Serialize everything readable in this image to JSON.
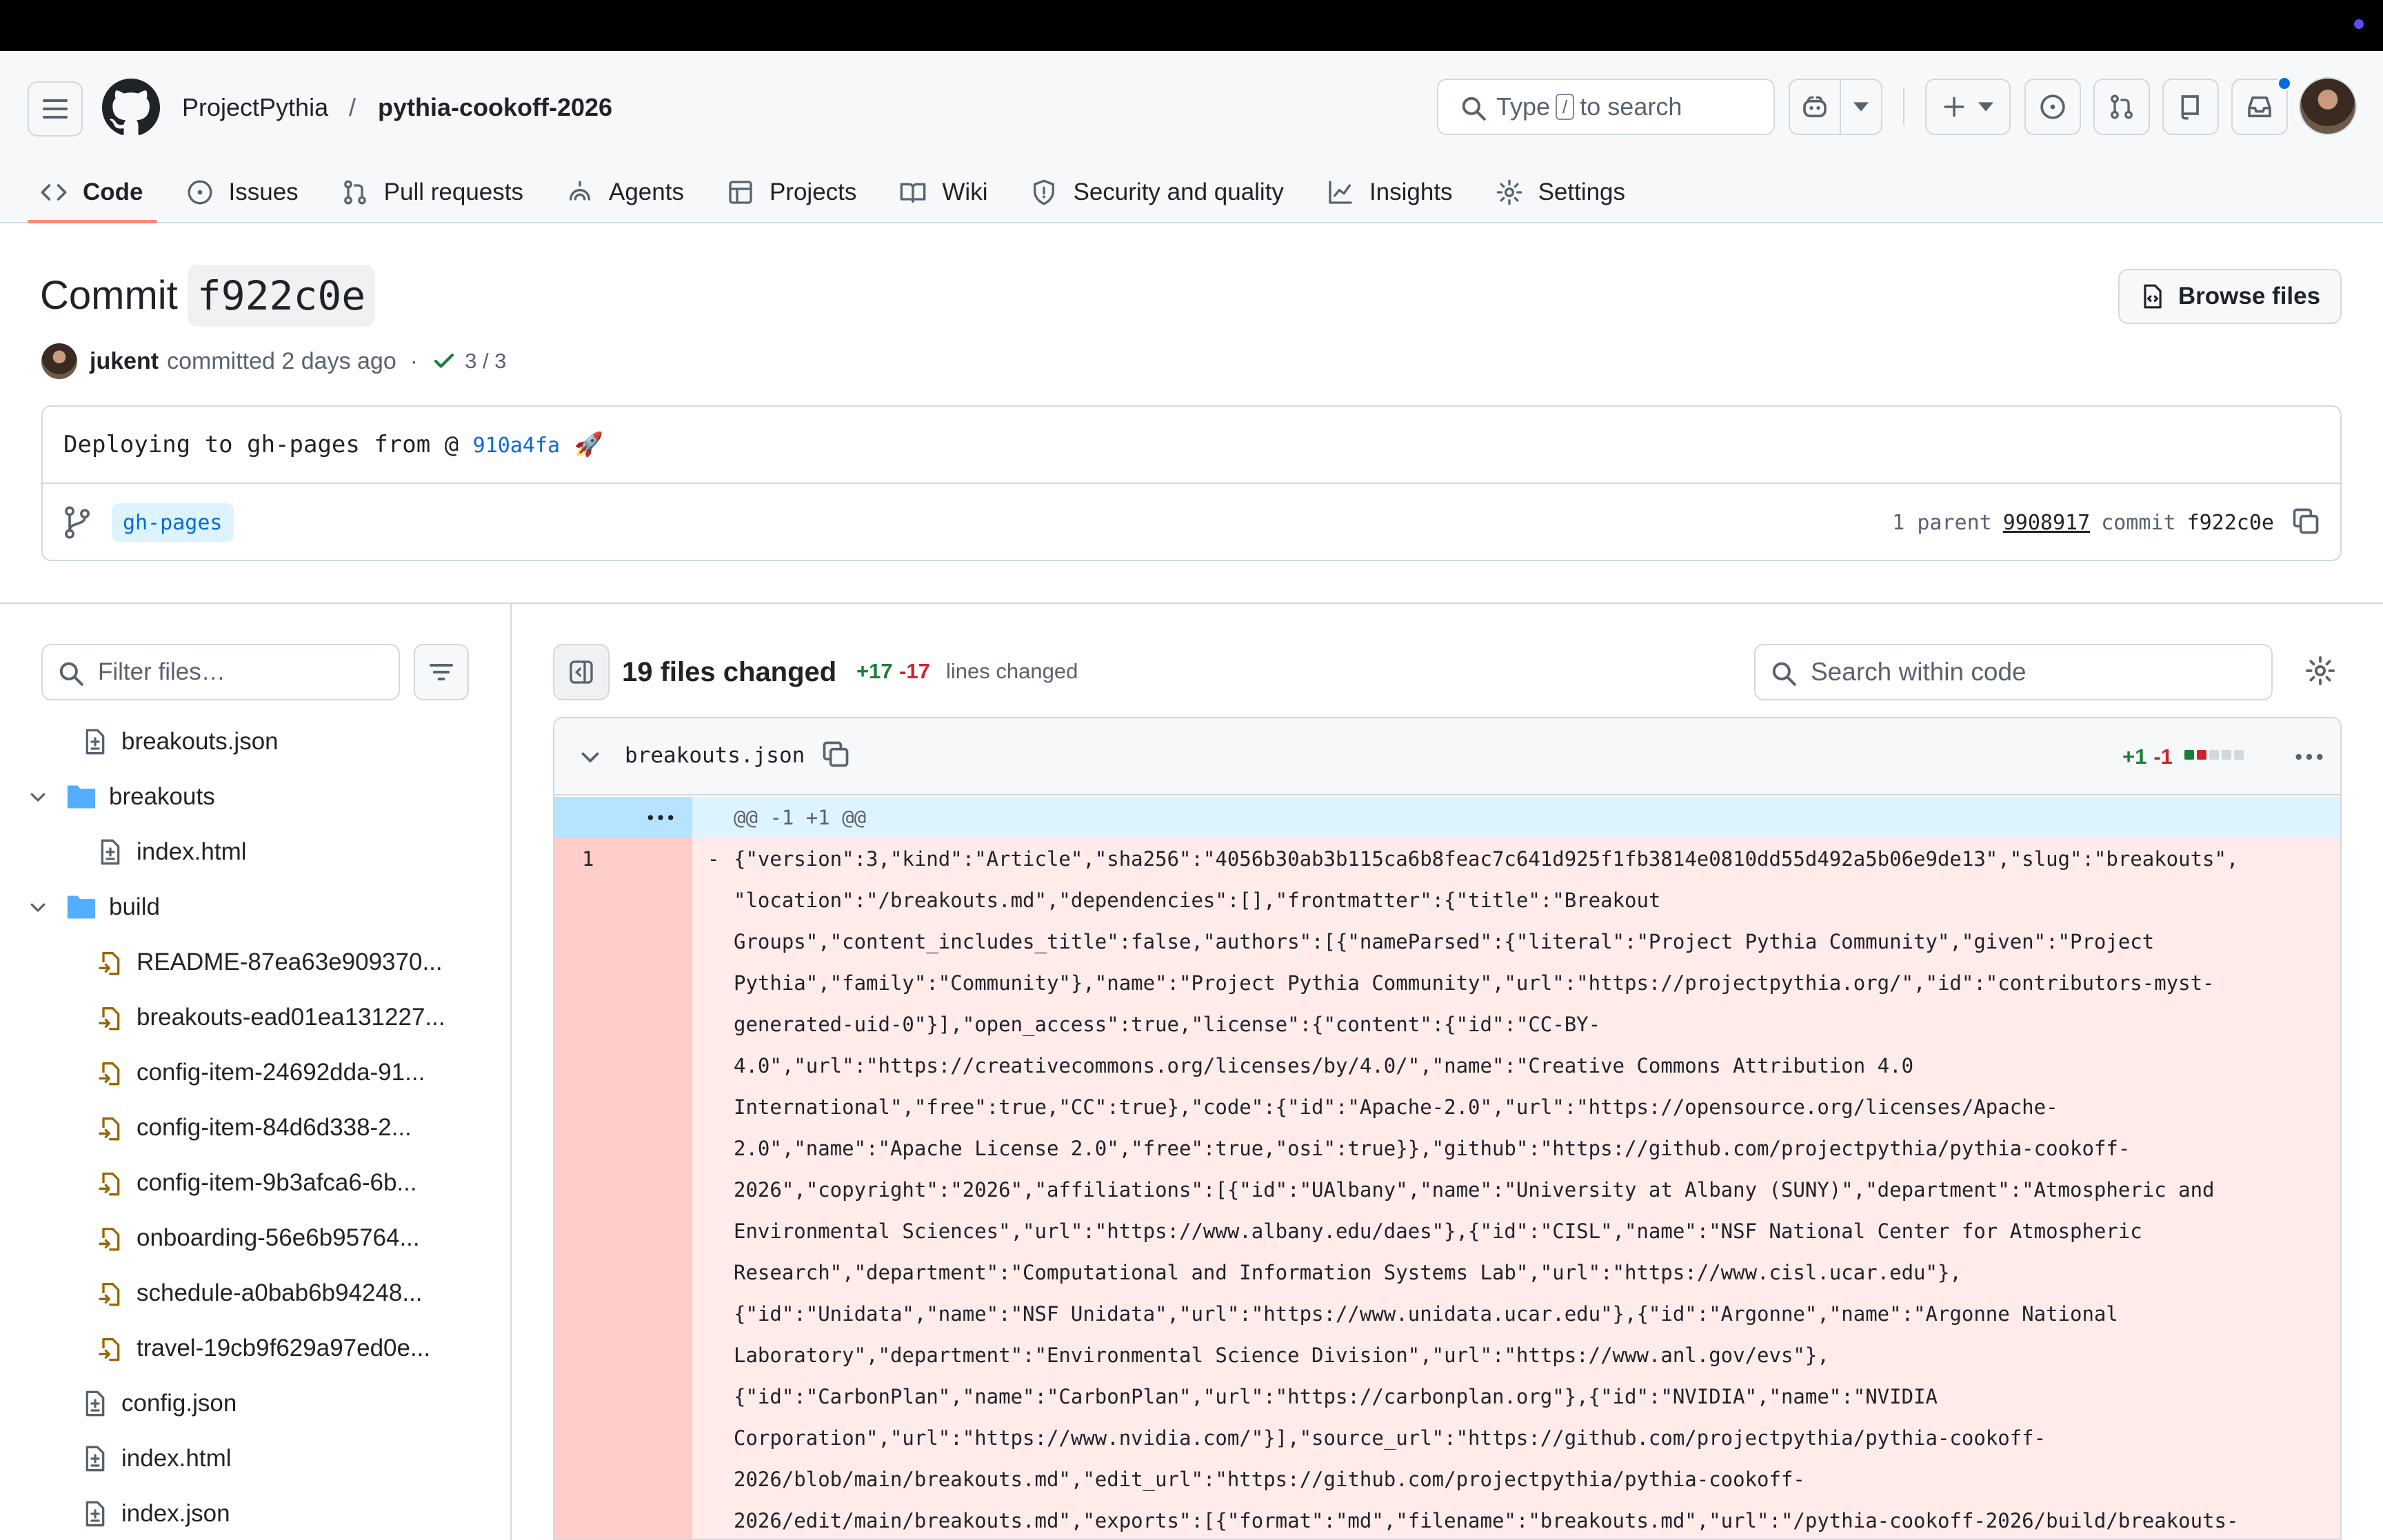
{
  "header": {
    "owner": "ProjectPythia",
    "separator": "/",
    "repo": "pythia-cookoff-2026",
    "search_prefix": "Type",
    "search_key": "/",
    "search_suffix": "to search"
  },
  "tabs": [
    {
      "label": "Code",
      "icon": "code-icon",
      "active": true
    },
    {
      "label": "Issues",
      "icon": "issue-icon"
    },
    {
      "label": "Pull requests",
      "icon": "pull-request-icon"
    },
    {
      "label": "Agents",
      "icon": "agents-icon"
    },
    {
      "label": "Projects",
      "icon": "table-icon"
    },
    {
      "label": "Wiki",
      "icon": "book-icon"
    },
    {
      "label": "Security and quality",
      "icon": "shield-icon"
    },
    {
      "label": "Insights",
      "icon": "graph-icon"
    },
    {
      "label": "Settings",
      "icon": "gear-icon"
    }
  ],
  "commit": {
    "title": "Commit",
    "sha": "f922c0e",
    "browse_files": "Browse files",
    "author": "jukent",
    "action": "committed",
    "time": "2 days ago",
    "checks": "3 / 3",
    "message_prefix": "Deploying to gh-pages from @",
    "message_link": "910a4fa",
    "message_emoji": "🚀",
    "branch": "gh-pages",
    "parent_label": "1 parent",
    "parent_sha": "9908917",
    "commit_label": "commit",
    "commit_sha": "f922c0e"
  },
  "sidebar": {
    "filter_placeholder": "Filter files…",
    "tree": [
      {
        "name": "breakouts.json",
        "type": "file",
        "depth": 1
      },
      {
        "name": "breakouts",
        "type": "folder",
        "depth": 0
      },
      {
        "name": "index.html",
        "type": "file",
        "depth": 2
      },
      {
        "name": "build",
        "type": "folder",
        "depth": 0
      },
      {
        "name": "README-87ea63e909370...",
        "type": "moved",
        "depth": 2
      },
      {
        "name": "breakouts-ead01ea131227...",
        "type": "moved",
        "depth": 2
      },
      {
        "name": "config-item-24692dda-91...",
        "type": "moved",
        "depth": 2
      },
      {
        "name": "config-item-84d6d338-2...",
        "type": "moved",
        "depth": 2
      },
      {
        "name": "config-item-9b3afca6-6b...",
        "type": "moved",
        "depth": 2
      },
      {
        "name": "onboarding-56e6b95764...",
        "type": "moved",
        "depth": 2
      },
      {
        "name": "schedule-a0bab6b94248...",
        "type": "moved",
        "depth": 2
      },
      {
        "name": "travel-19cb9f629a97ed0e...",
        "type": "moved",
        "depth": 2
      },
      {
        "name": "config.json",
        "type": "file",
        "depth": 1
      },
      {
        "name": "index.html",
        "type": "file",
        "depth": 1
      },
      {
        "name": "index.json",
        "type": "file",
        "depth": 1
      }
    ]
  },
  "diff": {
    "files_changed": "19 files changed",
    "additions": "+17",
    "deletions": "-17",
    "lines_changed": "lines changed",
    "search_placeholder": "Search within code",
    "file": {
      "name": "breakouts.json",
      "additions": "+1",
      "deletions": "-1",
      "hunk": "@@ -1 +1 @@",
      "line_number": "1",
      "marker": "-",
      "lines": [
        "{\"version\":3,\"kind\":\"Article\",\"sha256\":\"4056b30ab3b115ca6b8feac7c641d925f1fb3814e0810dd55d492a5b06e9de13\",\"slug\":\"breakouts\",",
        "\"location\":\"/breakouts.md\",\"dependencies\":[],\"frontmatter\":{\"title\":\"Breakout",
        "Groups\",\"content_includes_title\":false,\"authors\":[{\"nameParsed\":{\"literal\":\"Project Pythia Community\",\"given\":\"Project",
        "Pythia\",\"family\":\"Community\"},\"name\":\"Project Pythia Community\",\"url\":\"https://projectpythia.org/\",\"id\":\"contributors-myst-",
        "generated-uid-0\"}],\"open_access\":true,\"license\":{\"content\":{\"id\":\"CC-BY-",
        "4.0\",\"url\":\"https://creativecommons.org/licenses/by/4.0/\",\"name\":\"Creative Commons Attribution 4.0",
        "International\",\"free\":true,\"CC\":true},\"code\":{\"id\":\"Apache-2.0\",\"url\":\"https://opensource.org/licenses/Apache-",
        "2.0\",\"name\":\"Apache License 2.0\",\"free\":true,\"osi\":true}},\"github\":\"https://github.com/projectpythia/pythia-cookoff-",
        "2026\",\"copyright\":\"2026\",\"affiliations\":[{\"id\":\"UAlbany\",\"name\":\"University at Albany (SUNY)\",\"department\":\"Atmospheric and",
        "Environmental Sciences\",\"url\":\"https://www.albany.edu/daes\"},{\"id\":\"CISL\",\"name\":\"NSF National Center for Atmospheric",
        "Research\",\"department\":\"Computational and Information Systems Lab\",\"url\":\"https://www.cisl.ucar.edu\"},",
        "{\"id\":\"Unidata\",\"name\":\"NSF Unidata\",\"url\":\"https://www.unidata.ucar.edu\"},{\"id\":\"Argonne\",\"name\":\"Argonne National",
        "Laboratory\",\"department\":\"Environmental Science Division\",\"url\":\"https://www.anl.gov/evs\"},",
        "{\"id\":\"CarbonPlan\",\"name\":\"CarbonPlan\",\"url\":\"https://carbonplan.org\"},{\"id\":\"NVIDIA\",\"name\":\"NVIDIA",
        "Corporation\",\"url\":\"https://www.nvidia.com/\"}],\"source_url\":\"https://github.com/projectpythia/pythia-cookoff-",
        "2026/blob/main/breakouts.md\",\"edit_url\":\"https://github.com/projectpythia/pythia-cookoff-",
        "2026/edit/main/breakouts.md\",\"exports\":[{\"format\":\"md\",\"filename\":\"breakouts.md\",\"url\":\"/pythia-cookoff-2026/build/breakouts-"
      ]
    }
  },
  "colors": {
    "accent": "#0969da",
    "tab_underline": "#fd8c73",
    "addition": "#1a7f37",
    "deletion": "#cf222e"
  }
}
